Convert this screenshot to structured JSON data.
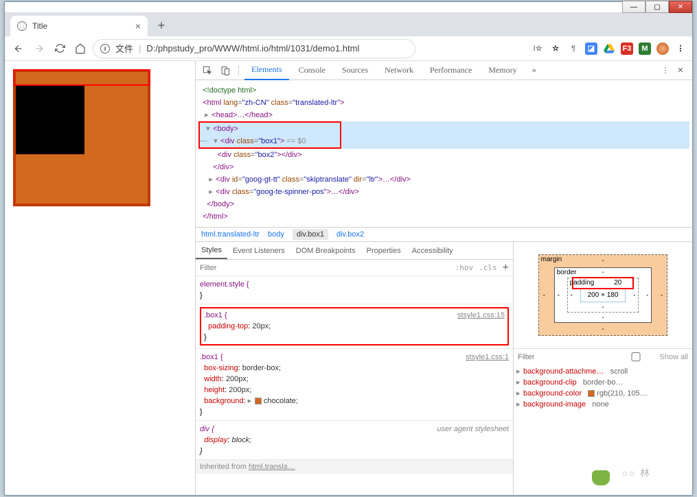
{
  "window": {
    "title": "Title"
  },
  "addr": {
    "file_label": "文件",
    "url": "D:/phpstudy_pro/WWW/html.io/html/1031/demo1.html"
  },
  "devtools": {
    "tabs": [
      "Elements",
      "Console",
      "Sources",
      "Network",
      "Performance",
      "Memory"
    ],
    "active": "Elements",
    "dom": {
      "l1": "<!doctype html>",
      "l2a": "<html ",
      "l2b": "lang",
      "l2c": "\"zh-CN\"",
      "l2d": "class",
      "l2e": "\"translated-ltr\"",
      "l2f": ">",
      "l3": "<head>…</head>",
      "l4": "<body>",
      "l5a": "<div ",
      "l5b": "class",
      "l5c": "\"box1\"",
      "l5d": "> == $0",
      "l6a": "<div ",
      "l6b": "class",
      "l6c": "\"box2\"",
      "l6d": "></div>",
      "l7": "</div>",
      "l8a": "<div ",
      "l8b": "id",
      "l8c": "\"goog-gt-tt\"",
      "l8d": "class",
      "l8e": "\"skiptranslate\"",
      "l8f": "dir",
      "l8g": "\"ltr\"",
      "l8h": ">…</div>",
      "l9a": "<div ",
      "l9b": "class",
      "l9c": "\"goog-te-spinner-pos\"",
      "l9d": ">…</div>",
      "l10": "</body>",
      "l11": "</html>"
    },
    "crumbs": [
      "html.translated-ltr",
      "body",
      "div.box1",
      "div.box2"
    ],
    "styles_tabs": [
      "Styles",
      "Event Listeners",
      "DOM Breakpoints",
      "Properties",
      "Accessibility"
    ],
    "filter": "Filter",
    "hov": ":hov",
    "cls": ".cls",
    "r0": {
      "sel": "element.style {",
      "close": "}"
    },
    "r1": {
      "sel": ".box1 {",
      "p": "padding-top",
      "v": "20px;",
      "src": "stsyle1.css:15",
      "close": "}"
    },
    "r2": {
      "sel": ".box1 {",
      "src": "stsyle1.css:1",
      "p1": "box-sizing",
      "v1": "border-box;",
      "p2": "width",
      "v2": "200px;",
      "p3": "height",
      "v3": "200px;",
      "p4": "background",
      "v4": "chocolate;",
      "close": "}"
    },
    "r3": {
      "sel": "div {",
      "ua": "user agent stylesheet",
      "p": "display",
      "v": "block;",
      "close": "}"
    },
    "inherit": "Inherited from",
    "inherit_el": "html.transla…"
  },
  "boxmodel": {
    "margin": "margin",
    "border": "border",
    "padding": "padding",
    "pad_top": "20",
    "size": "200 × 180",
    "dash": "-"
  },
  "computed": {
    "filter": "Filter",
    "showall": "Show all",
    "rows": [
      {
        "p": "background-attachme…",
        "v": "scroll"
      },
      {
        "p": "background-clip",
        "v": "border-bo…"
      },
      {
        "p": "background-color",
        "v": "rgb(210, 105…"
      },
      {
        "p": "background-image",
        "v": "none"
      }
    ]
  },
  "watermark": "林"
}
